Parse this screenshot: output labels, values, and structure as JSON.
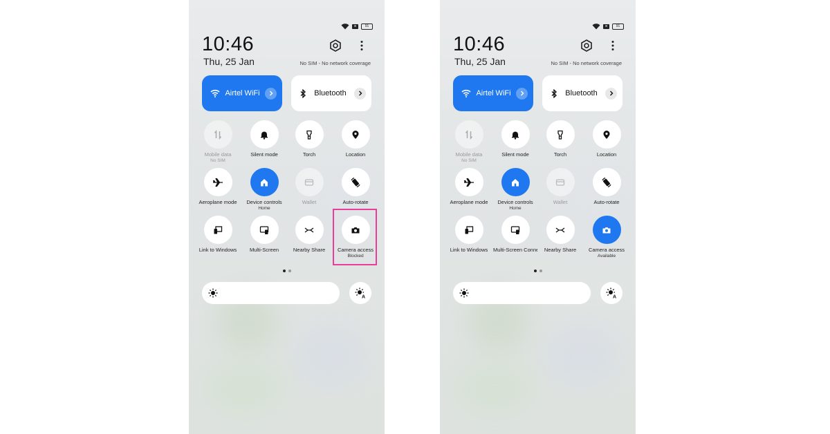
{
  "colors": {
    "accent": "#1f78f0",
    "highlight": "#e83e9a"
  },
  "panels": [
    {
      "time": "10:46",
      "date": "Thu, 25 Jan",
      "network": "No SIM - No network coverage",
      "battery": "91",
      "wifi_tile": {
        "label": "Airtel WiFi",
        "icon": "wifi-icon"
      },
      "bt_tile": {
        "label": "Bluetooth",
        "icon": "bluetooth-icon"
      },
      "toggles": [
        {
          "name": "Mobile data",
          "sub": "No SIM",
          "icon": "mobile-data-icon"
        },
        {
          "name": "Silent mode",
          "sub": "",
          "icon": "bell-icon"
        },
        {
          "name": "Torch",
          "sub": "",
          "icon": "torch-icon"
        },
        {
          "name": "Location",
          "sub": "",
          "icon": "location-icon"
        },
        {
          "name": "Aeroplane mode",
          "sub": "",
          "icon": "airplane-icon"
        },
        {
          "name": "Device controls",
          "sub": "Home",
          "icon": "home-icon"
        },
        {
          "name": "Wallet",
          "sub": "",
          "icon": "wallet-icon"
        },
        {
          "name": "Auto-rotate",
          "sub": "",
          "icon": "auto-rotate-icon"
        },
        {
          "name": "Link to Windows",
          "sub": "",
          "icon": "link-windows-icon"
        },
        {
          "name": "Multi-Screen",
          "sub": "",
          "icon": "multi-screen-icon"
        },
        {
          "name": "Nearby Share",
          "sub": "",
          "icon": "nearby-share-icon"
        },
        {
          "name": "Camera access",
          "sub": "Blocked",
          "icon": "camera-icon"
        }
      ]
    },
    {
      "time": "10:46",
      "date": "Thu, 25 Jan",
      "network": "No SIM - No network coverage",
      "battery": "91",
      "wifi_tile": {
        "label": "Airtel WiFi",
        "icon": "wifi-icon"
      },
      "bt_tile": {
        "label": "Bluetooth",
        "icon": "bluetooth-icon"
      },
      "toggles": [
        {
          "name": "Mobile data",
          "sub": "No SIM",
          "icon": "mobile-data-icon"
        },
        {
          "name": "Silent mode",
          "sub": "",
          "icon": "bell-icon"
        },
        {
          "name": "Torch",
          "sub": "",
          "icon": "torch-icon"
        },
        {
          "name": "Location",
          "sub": "",
          "icon": "location-icon"
        },
        {
          "name": "Aeroplane mode",
          "sub": "",
          "icon": "airplane-icon"
        },
        {
          "name": "Device controls",
          "sub": "Home",
          "icon": "home-icon"
        },
        {
          "name": "Wallet",
          "sub": "",
          "icon": "wallet-icon"
        },
        {
          "name": "Auto-rotate",
          "sub": "",
          "icon": "auto-rotate-icon"
        },
        {
          "name": "Link to Windows",
          "sub": "",
          "icon": "link-windows-icon"
        },
        {
          "name": "Multi-Screen Connect",
          "sub": "",
          "icon": "multi-screen-icon"
        },
        {
          "name": "Nearby Share",
          "sub": "",
          "icon": "nearby-share-icon"
        },
        {
          "name": "Camera access",
          "sub": "Available",
          "icon": "camera-icon"
        }
      ]
    }
  ]
}
